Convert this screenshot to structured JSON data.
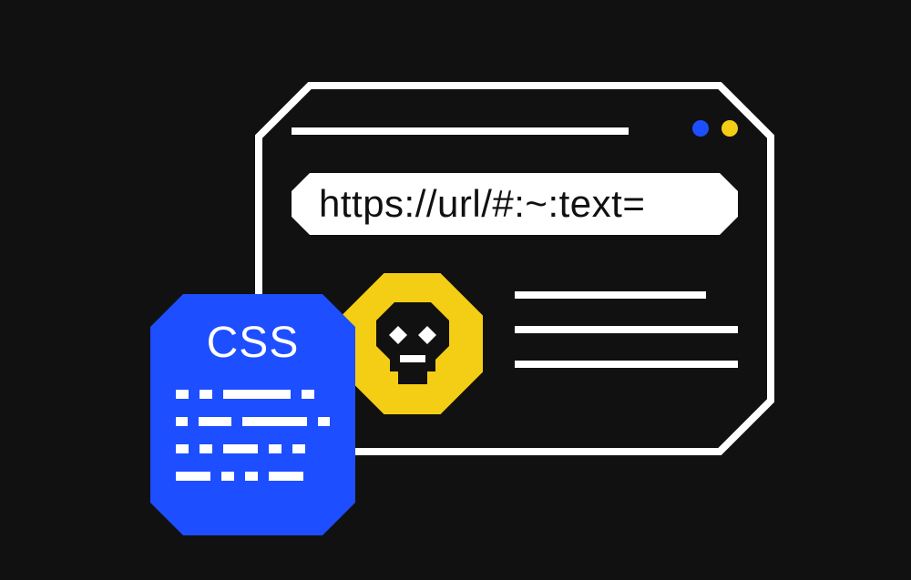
{
  "browser": {
    "url_text": "https://url/#:~:text=",
    "dots": {
      "first": "blue",
      "second": "yellow"
    }
  },
  "css_card": {
    "title": "CSS"
  },
  "colors": {
    "background": "#111111",
    "accent_blue": "#1D4EFF",
    "accent_yellow": "#F4CE14",
    "white": "#ffffff"
  },
  "icons": {
    "skull": "skull-icon"
  }
}
